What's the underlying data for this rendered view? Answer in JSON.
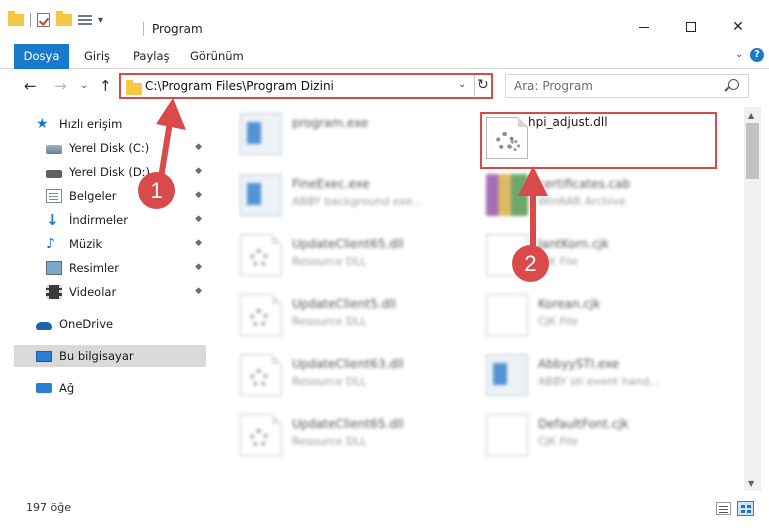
{
  "window": {
    "title": "Program",
    "controls": {
      "minimize_icon": "minimize-icon",
      "maximize_icon": "maximize-icon",
      "close_label": "✕"
    }
  },
  "quick_access_toolbar": {
    "dropdown_label": "▾"
  },
  "ribbon": {
    "tabs": [
      "Dosya",
      "Giriş",
      "Paylaş",
      "Görünüm"
    ],
    "collapse_label": "⌄",
    "help_label": "?"
  },
  "navigation": {
    "back_label": "←",
    "forward_label": "→",
    "recent_label": "⌄",
    "up_label": "↑",
    "address": "C:\\Program Files\\Program Dizini",
    "address_dropdown_label": "⌄",
    "refresh_label": "↻",
    "search_placeholder": "Ara: Program"
  },
  "sidebar": {
    "items": [
      {
        "label": "Hızlı erişim",
        "icon": "star-icon",
        "pinned": false
      },
      {
        "label": "Yerel Disk (C:)",
        "icon": "drive-icon",
        "pinned": true
      },
      {
        "label": "Yerel Disk (D:)",
        "icon": "drive-icon",
        "pinned": true
      },
      {
        "label": "Belgeler",
        "icon": "documents-icon",
        "pinned": true
      },
      {
        "label": "İndirmeler",
        "icon": "downloads-icon",
        "pinned": true
      },
      {
        "label": "Müzik",
        "icon": "music-icon",
        "pinned": true
      },
      {
        "label": "Resimler",
        "icon": "pictures-icon",
        "pinned": true
      },
      {
        "label": "Videolar",
        "icon": "videos-icon",
        "pinned": true
      },
      {
        "label": "OneDrive",
        "icon": "cloud-icon",
        "pinned": false
      },
      {
        "label": "Bu bilgisayar",
        "icon": "computer-icon",
        "pinned": false,
        "selected": true
      },
      {
        "label": "Ağ",
        "icon": "network-icon",
        "pinned": false
      }
    ],
    "pin_glyph": "📌"
  },
  "files": [
    {
      "name": "program.exe",
      "type": "",
      "icon": "exe-icon",
      "blurred": true
    },
    {
      "name": "hpi_adjust.dll",
      "type": "",
      "icon": "dll-gear-icon",
      "blurred": false,
      "highlighted": true
    },
    {
      "name": "FineExec.exe",
      "type": "ABBY background exe...",
      "icon": "exe-icon",
      "blurred": true
    },
    {
      "name": "certificates.cab",
      "type": "WinRAR Archive",
      "icon": "archive-icon",
      "blurred": true
    },
    {
      "name": "UpdateClient65.dll",
      "type": "Resource DLL",
      "icon": "dll-gear-icon",
      "blurred": true
    },
    {
      "name": "JantKorn.cjk",
      "type": "CJK File",
      "icon": "file-icon",
      "blurred": true
    },
    {
      "name": "UpdateClient5.dll",
      "type": "Resource DLL",
      "icon": "dll-gear-icon",
      "blurred": true
    },
    {
      "name": "Korean.cjk",
      "type": "CJK File",
      "icon": "file-icon",
      "blurred": true
    },
    {
      "name": "UpdateClient63.dll",
      "type": "Resource DLL",
      "icon": "dll-gear-icon",
      "blurred": true
    },
    {
      "name": "AbbyySTI.exe",
      "type": "ABBY sti event hand...",
      "icon": "exe-icon",
      "blurred": true
    },
    {
      "name": "UpdateClient65.dll",
      "type": "Resource DLL",
      "icon": "dll-gear-icon",
      "blurred": true
    },
    {
      "name": "DefaultFont.cjk",
      "type": "CJK File",
      "icon": "file-icon",
      "blurred": true
    }
  ],
  "annotations": {
    "marker_1": "1",
    "marker_2": "2",
    "accent_color": "#d94b4b"
  },
  "status": {
    "item_count": "197 öğe"
  },
  "colors": {
    "file_tab": "#1979ca",
    "selection": "#d9d9d9",
    "callout": "#d94b4b"
  }
}
